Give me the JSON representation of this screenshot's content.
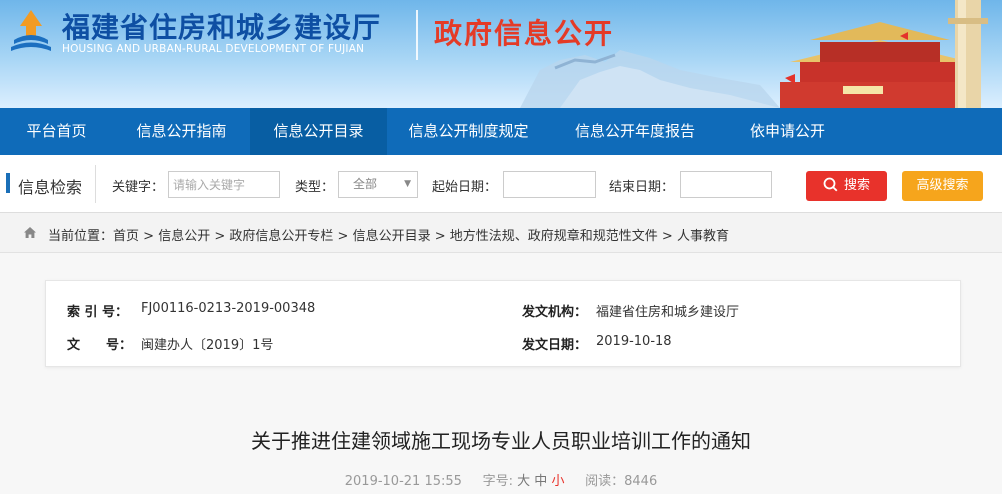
{
  "header": {
    "title": "福建省住房和城乡建设厅",
    "subtitle": "HOUSING AND URBAN-RURAL DEVELOPMENT OF FUJIAN",
    "section": "政府信息公开"
  },
  "nav": {
    "items": [
      {
        "label": "平台首页"
      },
      {
        "label": "信息公开指南"
      },
      {
        "label": "信息公开目录"
      },
      {
        "label": "信息公开制度规定"
      },
      {
        "label": "信息公开年度报告"
      },
      {
        "label": "依申请公开"
      }
    ],
    "active": "信息公开目录"
  },
  "search": {
    "title": "信息检索",
    "keyword_label": "关键字：",
    "keyword_placeholder": "请输入关键字",
    "keyword_value": "",
    "type_label": "类型：",
    "type_value": "全部",
    "start_label": "起始日期：",
    "start_value": "",
    "end_label": "结束日期：",
    "end_value": "",
    "search_button": "搜索",
    "advanced_button": "高级搜索"
  },
  "breadcrumb": {
    "prefix": "当前位置：",
    "items": [
      "首页",
      "信息公开",
      "政府信息公开专栏",
      "信息公开目录",
      "地方性法规、政府规章和规范性文件",
      "人事教育"
    ],
    "separator": " > "
  },
  "meta": {
    "index_label": "索 引 号：",
    "index_value": "FJ00116-0213-2019-00348",
    "issuer_label": "发文机构：",
    "issuer_value": "福建省住房和城乡建设厅",
    "docno_label": "文　　号：",
    "docno_value": "闽建办人〔2019〕1号",
    "date_label": "发文日期：",
    "date_value": "2019-10-18"
  },
  "article": {
    "title": "关于推进住建领域施工现场专业人员职业培训工作的通知",
    "published": "2019-10-21 15:55",
    "fontsize_label": "字号:",
    "fontsize_options": [
      "大",
      "中",
      "小"
    ],
    "fontsize_selected": "小",
    "reads_label": "阅读：",
    "reads_value": "8446"
  },
  "colors": {
    "nav_bg": "#0f6bb9",
    "nav_active": "#085ea3",
    "title_blue": "#0e4fa3",
    "section_red": "#e43b27",
    "search_red": "#e8322b",
    "advanced_orange": "#f6a51c"
  }
}
